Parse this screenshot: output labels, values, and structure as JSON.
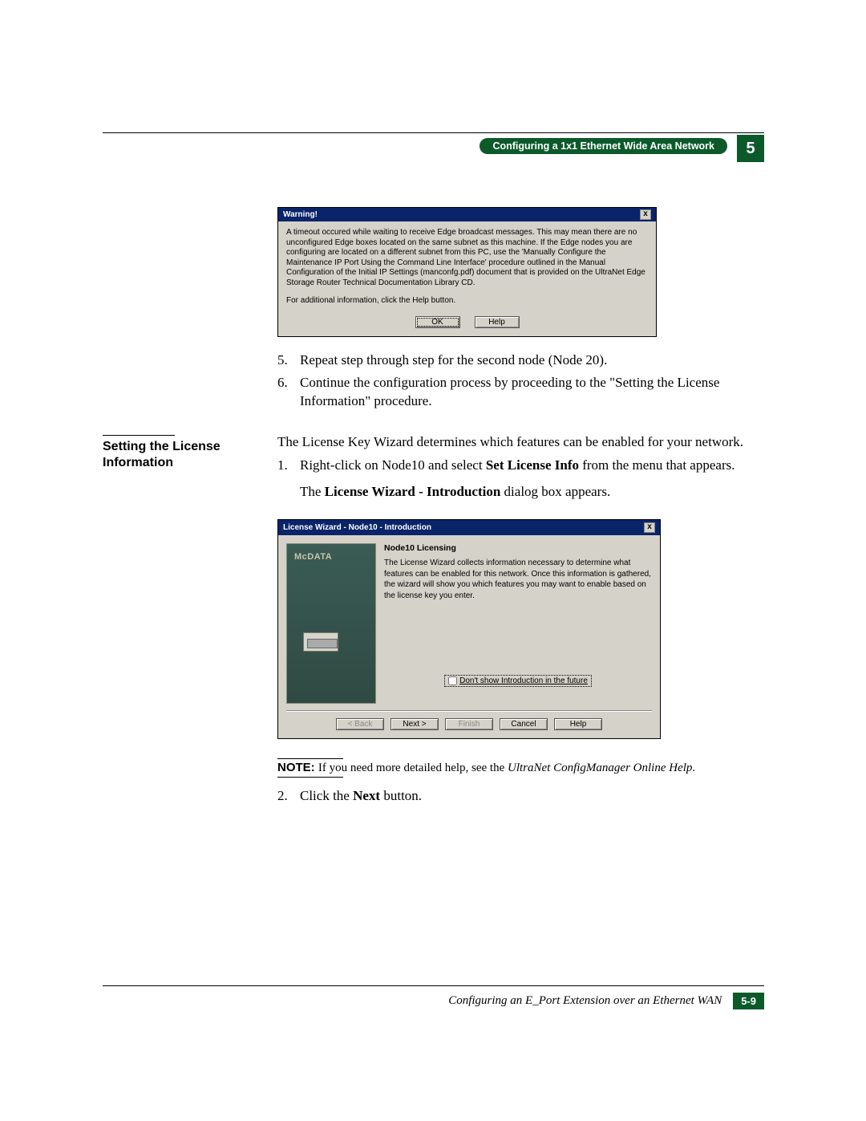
{
  "header": {
    "ribbon": "Configuring a 1x1 Ethernet Wide Area Network",
    "chapter": "5"
  },
  "warning": {
    "title": "Warning!",
    "body1": "A timeout occured while waiting to receive Edge broadcast messages. This may mean there are no unconfigured Edge boxes located on the same subnet as this machine. If the Edge nodes you are configuring are located on a different subnet from this PC, use the 'Manually Configure the Maintenance IP Port Using the Command Line Interface' procedure outlined in the Manual Configuration of the Initial IP Settings (manconfg.pdf) document that is provided on the UltraNet Edge Storage Router Technical Documentation Library CD.",
    "body2": "For additional information, click the Help button.",
    "ok": "OK",
    "help": "Help"
  },
  "steps_a": {
    "s5_num": "5.",
    "s5_text": "Repeat step  through step  for the second node (Node 20).",
    "s6_num": "6.",
    "s6_text": "Continue the configuration process by proceeding to the \"Setting the License Information\" procedure."
  },
  "section_title": "Setting the License Information",
  "section_intro": "The License Key Wizard determines which features can be enabled for your network.",
  "steps_b": {
    "s1_num": "1.",
    "s1_a": "Right-click on Node10 and select ",
    "s1_bold": "Set License Info",
    "s1_b": " from the menu that appears.",
    "s1_c_a": "The ",
    "s1_c_bold": "License Wizard - Introduction",
    "s1_c_b": " dialog box appears."
  },
  "wizard": {
    "title": "License Wizard - Node10 - Introduction",
    "logo": "McDATA",
    "heading": "Node10 Licensing",
    "body": "The License Wizard collects information necessary to determine what features can be enabled for this network. Once this information is gathered, the wizard will show you which features you may want to enable based on the license key you enter.",
    "checkbox": "Don't show Introduction in the future",
    "back": "< Back",
    "next": "Next >",
    "finish": "Finish",
    "cancel": "Cancel",
    "help": "Help"
  },
  "note": {
    "label": "NOTE: ",
    "text_a": "If you need more detailed help, see the ",
    "text_i": "UltraNet ConfigManager Online Help",
    "text_b": "."
  },
  "steps_c": {
    "s2_num": "2.",
    "s2_a": "Click the ",
    "s2_bold": "Next",
    "s2_b": " button."
  },
  "footer": {
    "title": "Configuring an E_Port Extension over an Ethernet WAN",
    "page": "5-9"
  }
}
